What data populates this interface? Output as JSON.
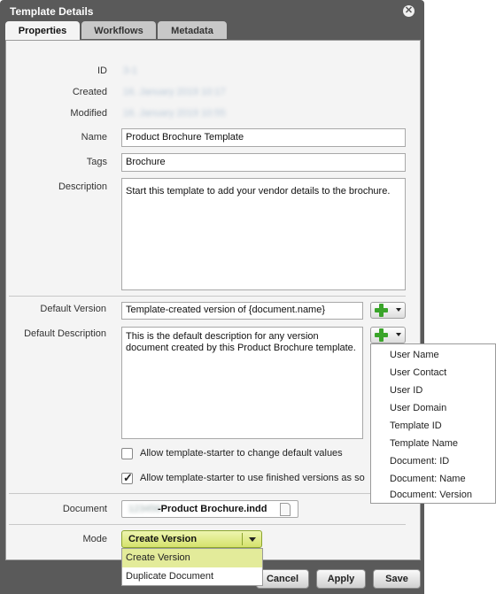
{
  "dialog": {
    "title": "Template Details"
  },
  "tabs": [
    {
      "label": "Properties"
    },
    {
      "label": "Workflows"
    },
    {
      "label": "Metadata"
    }
  ],
  "fields": {
    "id_label": "ID",
    "id_value": "3-1",
    "created_label": "Created",
    "created_value": "16. January 2019 10:17",
    "modified_label": "Modified",
    "modified_value": "16. January 2019 10:55",
    "name_label": "Name",
    "name_value": "Product Brochure Template",
    "tags_label": "Tags",
    "tags_value": "Brochure",
    "description_label": "Description",
    "description_value": "Start this template to add your vendor details to the brochure.",
    "default_version_label": "Default Version",
    "default_version_value": "Template-created version of {document.name}",
    "default_description_label": "Default Description",
    "default_description_value": "This is the default description for any version document created by this Product Brochure template.",
    "allow_change_label": "Allow template-starter to change default values",
    "allow_finished_label": "Allow template-starter to use finished versions as so",
    "document_label": "Document",
    "document_blurred": "123456",
    "document_value": "-Product Brochure.indd",
    "mode_label": "Mode",
    "mode_value": "Create Version"
  },
  "mode_options": [
    "Create Version",
    "Duplicate Document"
  ],
  "placeholder_menu": [
    "User Name",
    "User Contact",
    "User ID",
    "User Domain",
    "Template ID",
    "Template Name",
    "Document: ID",
    "Document: Name",
    "Document: Version"
  ],
  "buttons": {
    "cancel": "Cancel",
    "apply": "Apply",
    "save": "Save"
  },
  "colors": {
    "accent": "#d5e26c",
    "add_icon": "#3aa42a"
  }
}
